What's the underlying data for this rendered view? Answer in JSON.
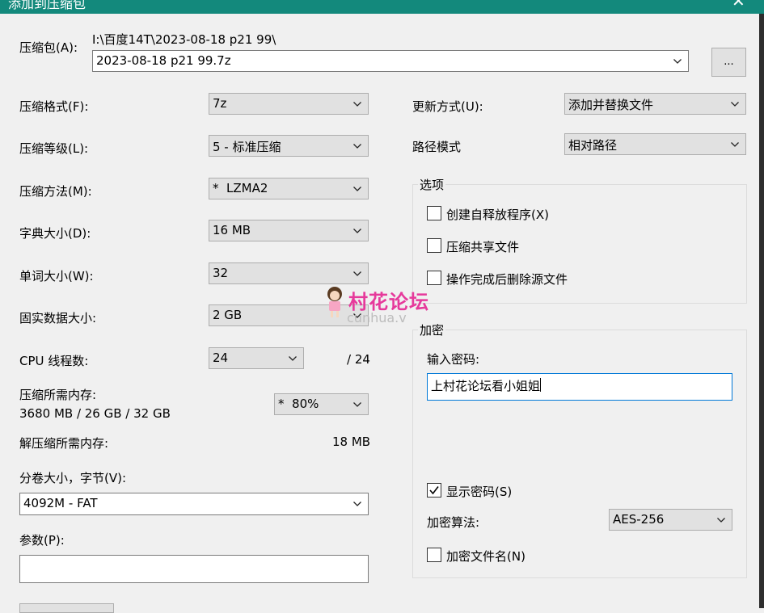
{
  "window": {
    "title": "添加到压缩包",
    "close_glyph": "✕"
  },
  "archive": {
    "label": "压缩包(A):",
    "path": "I:\\百度14T\\2023-08-18 p21 99\\",
    "filename": "2023-08-18 p21 99.7z",
    "browse_label": "..."
  },
  "left": {
    "format": {
      "label": "压缩格式(F):",
      "value": "7z"
    },
    "level": {
      "label": "压缩等级(L):",
      "value": "5 - 标准压缩"
    },
    "method": {
      "label": "压缩方法(M):",
      "value": "*  LZMA2"
    },
    "dict": {
      "label": "字典大小(D):",
      "value": "16 MB"
    },
    "word": {
      "label": "单词大小(W):",
      "value": "32"
    },
    "solid": {
      "label": "固实数据大小:",
      "value": "2 GB"
    },
    "threads": {
      "label": "CPU 线程数:",
      "value": "24",
      "max": "/ 24"
    },
    "mem_compress": {
      "label": "压缩所需内存:",
      "detail": "3680 MB / 26 GB / 32 GB",
      "value": "*  80%"
    },
    "mem_decompress": {
      "label": "解压缩所需内存:",
      "value": "18 MB"
    },
    "volume": {
      "label": "分卷大小，字节(V):",
      "value": "4092M - FAT"
    },
    "params": {
      "label": "参数(P):",
      "value": ""
    }
  },
  "right": {
    "update": {
      "label": "更新方式(U):",
      "value": "添加并替换文件"
    },
    "pathmode": {
      "label": "路径模式",
      "value": "相对路径"
    },
    "options": {
      "title": "选项",
      "sfx": {
        "label": "创建自释放程序(X)",
        "checked": false
      },
      "shared": {
        "label": "压缩共享文件",
        "checked": false
      },
      "delete": {
        "label": "操作完成后删除源文件",
        "checked": false
      }
    },
    "encryption": {
      "title": "加密",
      "password_label": "输入密码:",
      "password_value": "上村花论坛看小姐姐",
      "show_password": {
        "label": "显示密码(S)",
        "checked": true
      },
      "method_label": "加密算法:",
      "method_value": "AES-256",
      "encrypt_names": {
        "label": "加密文件名(N)",
        "checked": false
      }
    }
  },
  "watermark": {
    "text": "村花论坛",
    "sub": "cunhua.v"
  },
  "colors": {
    "titlebar": "#13897c",
    "focus": "#0078d7",
    "watermark": "#e6399b"
  }
}
